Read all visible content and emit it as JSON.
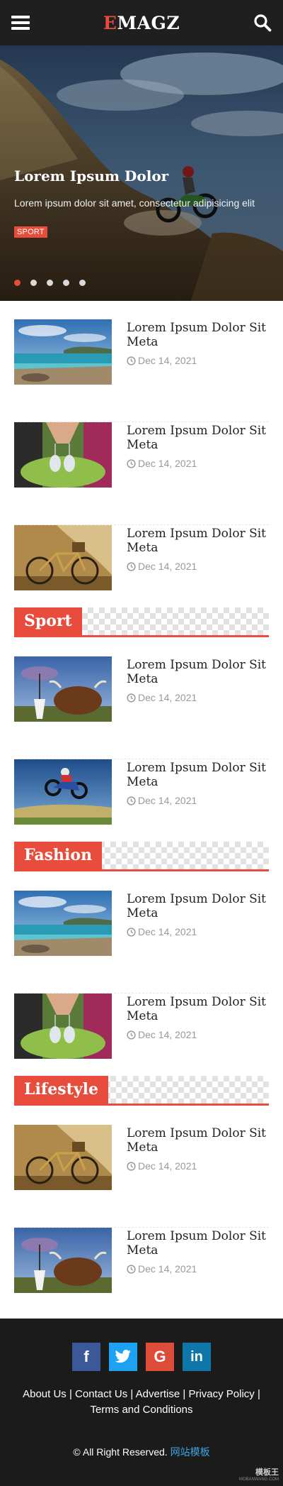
{
  "header": {
    "logo_accent": "E",
    "logo_rest": "MAGZ"
  },
  "hero": {
    "title": "Lorem Ipsum Dolor",
    "excerpt": "Lorem ipsum dolor sit amet, consectetur adipisicing elit",
    "badge": "SPORT",
    "slides": 5,
    "active_slide": 1
  },
  "posts": [
    {
      "title": "Lorem Ipsum Dolor Sit Meta",
      "date": "Dec 14, 2021",
      "image": "beach"
    },
    {
      "title": "Lorem Ipsum Dolor Sit Meta",
      "date": "Dec 14, 2021",
      "image": "baby-shoes"
    },
    {
      "title": "Lorem Ipsum Dolor Sit Meta",
      "date": "Dec 14, 2021",
      "image": "bicycle"
    }
  ],
  "sections": [
    {
      "label": "Sport",
      "posts": [
        {
          "title": "Lorem Ipsum Dolor Sit Meta",
          "date": "Dec 14, 2021",
          "image": "yak-umbrella"
        },
        {
          "title": "Lorem Ipsum Dolor Sit Meta",
          "date": "Dec 14, 2021",
          "image": "motocross"
        }
      ]
    },
    {
      "label": "Fashion",
      "posts": [
        {
          "title": "Lorem Ipsum Dolor Sit Meta",
          "date": "Dec 14, 2021",
          "image": "beach"
        },
        {
          "title": "Lorem Ipsum Dolor Sit Meta",
          "date": "Dec 14, 2021",
          "image": "baby-shoes"
        }
      ]
    },
    {
      "label": "Lifestyle",
      "posts": [
        {
          "title": "Lorem Ipsum Dolor Sit Meta",
          "date": "Dec 14, 2021",
          "image": "bicycle"
        },
        {
          "title": "Lorem Ipsum Dolor Sit Meta",
          "date": "Dec 14, 2021",
          "image": "yak-umbrella"
        }
      ]
    }
  ],
  "footer": {
    "socials": [
      {
        "name": "facebook-icon",
        "glyph": "f",
        "color": "#3b5998"
      },
      {
        "name": "twitter-icon",
        "glyph": "",
        "color": "#1da1f2"
      },
      {
        "name": "google-icon",
        "glyph": "G",
        "color": "#dd4b39"
      },
      {
        "name": "linkedin-icon",
        "glyph": "in",
        "color": "#0e76a8"
      }
    ],
    "links": [
      "About Us",
      "Contact Us",
      "Advertise",
      "Privacy Policy",
      "Terms and Conditions"
    ],
    "copyright": "© All Right Reserved.",
    "copyright_link": "网站模板",
    "watermark_main": "模板王",
    "watermark_sub": "MOBANWANG.COM"
  },
  "colors": {
    "accent": "#e74c3c",
    "header_bg": "#1f1f1f",
    "footer_bg": "#1b1b1b",
    "link_blue": "#3ea4e3"
  }
}
